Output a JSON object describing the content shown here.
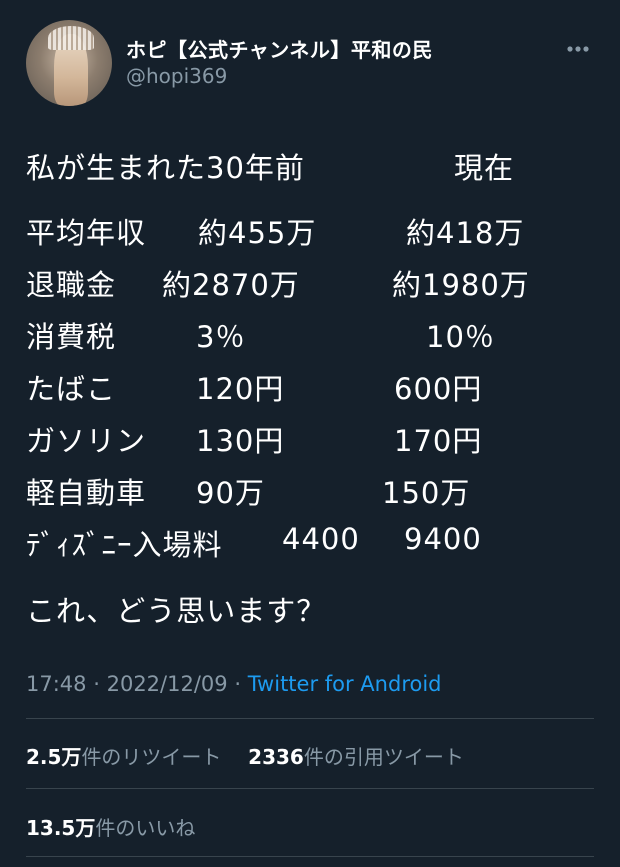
{
  "author": {
    "display_name": "ホピ【公式チャンネル】平和の民",
    "handle": "@hopi369"
  },
  "tweet": {
    "header": {
      "left": "私が生まれた30年前",
      "right": "現在"
    },
    "rows": [
      {
        "item": "平均年収",
        "then": "約455万",
        "now": "約418万"
      },
      {
        "item": "退職金",
        "then": "約2870万",
        "now": "約1980万"
      },
      {
        "item": "消費税",
        "then": "3％",
        "now": "10％"
      },
      {
        "item": "たばこ",
        "then": "120円",
        "now": "600円"
      },
      {
        "item": "ガソリン",
        "then": "130円",
        "now": "170円"
      },
      {
        "item": "軽自動車",
        "then": "90万",
        "now": "150万"
      },
      {
        "item": "ﾃﾞｨｽﾞﾆｰ入場料",
        "then": "4400",
        "now": "9400"
      }
    ],
    "closing": "これ、どう思います？"
  },
  "meta": {
    "time": "17:48",
    "separator1": "·",
    "date": "2022/12/09",
    "separator2": "·",
    "source": "Twitter for Android"
  },
  "stats": {
    "retweets_count": "2.5万",
    "retweets_label": "件のリツイート",
    "quotes_count": "2336",
    "quotes_label": "件の引用ツイート",
    "likes_count": "13.5万",
    "likes_label": "件のいいね"
  },
  "icons": {
    "more": "more-horizontal-icon",
    "avatar": "profile-photo"
  },
  "colors": {
    "background": "#15202b",
    "secondary_text": "#8899a6",
    "link": "#1d9bf0",
    "divider": "#38444d"
  }
}
